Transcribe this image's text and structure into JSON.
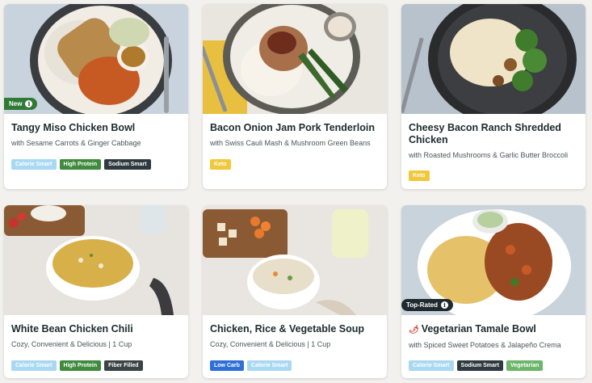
{
  "meals": [
    {
      "title": "Tangy Miso Chicken Bowl",
      "subtitle": "with Sesame Carrots & Ginger Cabbage",
      "badge": "New",
      "tags": [
        "Calorie Smart",
        "High Protein",
        "Sodium Smart"
      ]
    },
    {
      "title": "Bacon Onion Jam Pork Tenderloin",
      "subtitle": "with Swiss Cauli Mash & Mushroom Green Beans",
      "tags": [
        "Keto"
      ]
    },
    {
      "title": "Cheesy Bacon Ranch Shredded Chicken",
      "subtitle": "with Roasted Mushrooms & Garlic Butter Broccoli",
      "tags": [
        "Keto"
      ]
    },
    {
      "title": "White Bean Chicken Chili",
      "subtitle": "Cozy, Convenient & Delicious | 1 Cup",
      "tags": [
        "Calorie Smart",
        "High Protein",
        "Fiber Filled"
      ]
    },
    {
      "title": "Chicken, Rice & Vegetable Soup",
      "subtitle": "Cozy, Convenient & Delicious | 1 Cup",
      "tags": [
        "Low Carb",
        "Calorie Smart"
      ]
    },
    {
      "title": "Vegetarian Tamale Bowl",
      "subtitle": "with Spiced Sweet Potatoes & Jalapeño Crema",
      "badge": "Top-Rated",
      "spicy_icon": "chili-pepper-icon",
      "tags": [
        "Calorie Smart",
        "Sodium Smart",
        "Vegetarian"
      ]
    }
  ],
  "badge_info_glyph": "i",
  "colors": {
    "new_badge": "#2f7a35",
    "top_rated_badge": "#1f2a2e",
    "calorie_smart": "#a9d8f3",
    "high_protein": "#3f8a3d",
    "sodium_smart": "#2f3a40",
    "keto": "#f1c83c",
    "low_carb": "#2e6fd8",
    "vegetarian": "#6cb66a"
  }
}
